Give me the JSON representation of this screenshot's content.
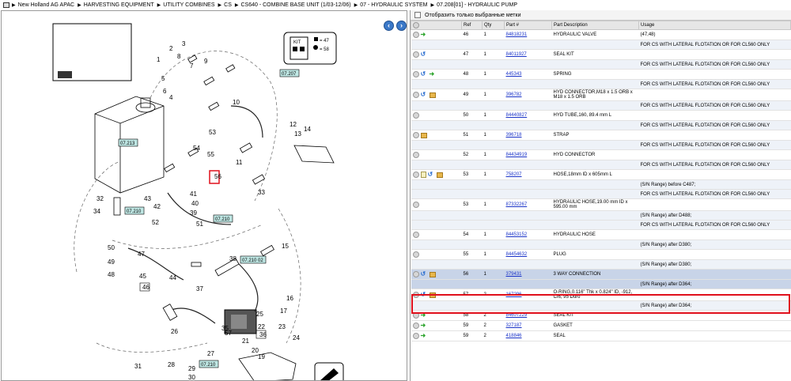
{
  "breadcrumb": {
    "items": [
      "New Holland AG APAC",
      "HARVESTING EQUIPMENT",
      "UTILITY COMBINES",
      "CS",
      "CS640 - COMBINE BASE UNIT (1/03-12/06)",
      "07 - HYDRAULIC SYSTEM",
      "07.208[01] - HYDRAULIC PUMP"
    ]
  },
  "diagram": {
    "callouts": [
      "1",
      "2",
      "3",
      "4",
      "5",
      "6",
      "7",
      "8",
      "9",
      "10",
      "11",
      "12",
      "13",
      "14",
      "15",
      "16",
      "17",
      "19",
      "20",
      "21",
      "22",
      "23",
      "24",
      "25",
      "26",
      "27",
      "28",
      "29",
      "30",
      "31",
      "32",
      "33",
      "34",
      "35",
      "36",
      "37",
      "38",
      "39",
      "40",
      "41",
      "42",
      "43",
      "44",
      "45",
      "46",
      "47",
      "48",
      "49",
      "50",
      "51",
      "52",
      "53",
      "54",
      "55",
      "56",
      "57"
    ],
    "kit_legend": {
      "label": "KIT",
      "count_a": "= 47",
      "count_b": "= 58"
    },
    "ref_tags": [
      "07.207",
      "07.213",
      "07.210",
      "07.210",
      "07.210 02",
      "07.210"
    ],
    "highlighted_callout": "56"
  },
  "parts_filter_label": "Отобразить только выбранные метки",
  "table": {
    "headers": [
      "",
      "Ref",
      "Qty",
      "Part #",
      "Part Description",
      "Usage"
    ],
    "rows": [
      {
        "type": "main",
        "icons": [
          "plus",
          "green"
        ],
        "ref": "46",
        "qty": "1",
        "part": "84818231",
        "desc": "HYDRAULIC VALVE",
        "usage": "(47,48)"
      },
      {
        "type": "note",
        "usage": "FOR CS WITH LATERAL FLOTATION OR FOR CL560 ONLY"
      },
      {
        "type": "main",
        "icons": [
          "plus",
          "blue"
        ],
        "ref": "47",
        "qty": "1",
        "part": "84011927",
        "desc": "SEAL KIT",
        "usage": ""
      },
      {
        "type": "note",
        "usage": "FOR CS WITH LATERAL FLOTATION OR FOR CL560 ONLY"
      },
      {
        "type": "main",
        "icons": [
          "plus",
          "blue",
          "green"
        ],
        "ref": "48",
        "qty": "1",
        "part": "445343",
        "desc": "SPRING",
        "usage": ""
      },
      {
        "type": "note",
        "usage": "FOR CS WITH LATERAL FLOTATION OR FOR CL560 ONLY"
      },
      {
        "type": "main",
        "icons": [
          "plus",
          "blue",
          "box"
        ],
        "ref": "49",
        "qty": "1",
        "part": "396782",
        "desc": "HYD CONNECTOR,M18 x 1.5 ORB x M18 x 1.5 ORB",
        "usage": ""
      },
      {
        "type": "note",
        "usage": "FOR CS WITH LATERAL FLOTATION OR FOR CL560 ONLY"
      },
      {
        "type": "main",
        "icons": [
          "plus"
        ],
        "ref": "50",
        "qty": "1",
        "part": "84440827",
        "desc": "HYD TUBE,160, 89.4 mm L",
        "usage": ""
      },
      {
        "type": "note",
        "usage": "FOR CS WITH LATERAL FLOTATION OR FOR CL560 ONLY"
      },
      {
        "type": "main",
        "icons": [
          "plus",
          "box"
        ],
        "ref": "51",
        "qty": "1",
        "part": "396718",
        "desc": "STRAP",
        "usage": ""
      },
      {
        "type": "note",
        "usage": "FOR CS WITH LATERAL FLOTATION OR FOR CL560 ONLY"
      },
      {
        "type": "main",
        "icons": [
          "plus"
        ],
        "ref": "52",
        "qty": "1",
        "part": "84434919",
        "desc": "HYD CONNECTOR",
        "usage": ""
      },
      {
        "type": "note",
        "usage": "FOR CS WITH LATERAL FLOTATION OR FOR CL560 ONLY"
      },
      {
        "type": "main",
        "icons": [
          "plus",
          "doc",
          "blue",
          "box"
        ],
        "ref": "53",
        "qty": "1",
        "part": "758207",
        "desc": "HOSE,18mm ID x 605mm L",
        "usage": ""
      },
      {
        "type": "note",
        "usage": "(S/N Range) before C487;"
      },
      {
        "type": "note",
        "usage": "FOR CS WITH LATERAL FLOTATION OR FOR CL560 ONLY"
      },
      {
        "type": "main",
        "icons": [
          "plus"
        ],
        "ref": "53",
        "qty": "1",
        "part": "87332267",
        "desc": "HYDRAULIC HOSE,19.00 mm ID x 595.00 mm",
        "usage": ""
      },
      {
        "type": "note",
        "usage": "(S/N Range) after D488;"
      },
      {
        "type": "note",
        "usage": "FOR CS WITH LATERAL FLOTATION OR FOR CL560 ONLY"
      },
      {
        "type": "main",
        "icons": [
          "plus"
        ],
        "ref": "54",
        "qty": "1",
        "part": "84453152",
        "desc": "HYDRAULIC HOSE",
        "usage": ""
      },
      {
        "type": "note",
        "usage": "(S/N Range) after D380;"
      },
      {
        "type": "main",
        "icons": [
          "plus"
        ],
        "ref": "55",
        "qty": "1",
        "part": "84454632",
        "desc": "PLUG",
        "usage": ""
      },
      {
        "type": "note",
        "usage": "(S/N Range) after D380;"
      },
      {
        "type": "sel",
        "icons": [
          "plus",
          "blue",
          "box"
        ],
        "ref": "56",
        "qty": "1",
        "part": "379431",
        "desc": "3 WAY CONNECTION",
        "usage": ""
      },
      {
        "type": "selnote",
        "usage": "(S/N Range) after D364;"
      },
      {
        "type": "main",
        "icons": [
          "plus",
          "blue",
          "box"
        ],
        "ref": "57",
        "qty": "2",
        "part": "167296",
        "desc": "O-RING,0.116\" Thk x 0.824\" ID, -912, CI6, 95 Duro",
        "usage": ""
      },
      {
        "type": "note",
        "usage": "(S/N Range) after D364;"
      },
      {
        "type": "main",
        "icons": [
          "plus",
          "green"
        ],
        "ref": "58",
        "qty": "2",
        "part": "84607229",
        "desc": "SEAL KIT",
        "usage": ""
      },
      {
        "type": "main",
        "icons": [
          "plus",
          "green"
        ],
        "ref": "59",
        "qty": "2",
        "part": "327187",
        "desc": "GASKET",
        "usage": ""
      },
      {
        "type": "main",
        "icons": [
          "plus",
          "green"
        ],
        "ref": "59",
        "qty": "2",
        "part": "418846",
        "desc": "SEAL",
        "usage": ""
      }
    ]
  }
}
